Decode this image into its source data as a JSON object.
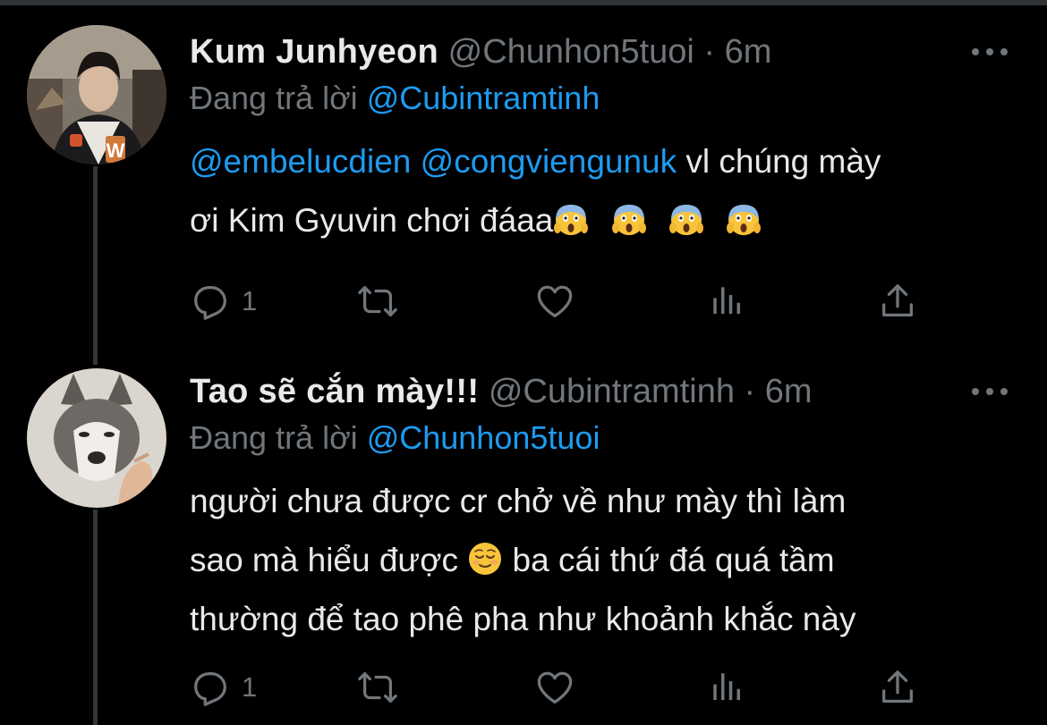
{
  "thread": [
    {
      "display_name": "Kum Junhyeon",
      "handle": "@Chunhon5tuoi",
      "separator": "·",
      "time": "6m",
      "replying_prefix": "Đang trả lời",
      "replying_to": "@Cubintramtinh",
      "text": {
        "mention_1": "@embelucdien",
        "mention_2": "@congviengunuk",
        "line_1_rest": " vl chúng mày",
        "line_2": "ơi Kim Gyuvin chơi đáaa"
      },
      "emojis": [
        "scream-emoji",
        "scream-emoji",
        "scream-emoji",
        "scream-emoji"
      ],
      "actions": {
        "reply_count": "1",
        "retweet_count": "",
        "like_count": ""
      },
      "avatar_icon": "avatar-person-photo"
    },
    {
      "display_name": "Tao sẽ cắn mày!!!",
      "handle": "@Cubintramtinh",
      "separator": "·",
      "time": "6m",
      "replying_prefix": "Đang trả lời",
      "replying_to": "@Chunhon5tuoi",
      "text": {
        "line_1": "người chưa được cr chở về như mày thì làm",
        "line_2_a": "sao mà hiểu được ",
        "line_2_b": "  ba cái thứ đá quá tầm",
        "line_3": "thường để tao phê pha như khoảnh khắc này"
      },
      "emojis": [
        "relieved-face-emoji"
      ],
      "actions": {
        "reply_count": "1",
        "retweet_count": "",
        "like_count": ""
      },
      "avatar_icon": "avatar-husky-dog-photo"
    }
  ],
  "icons": [
    "reply-icon",
    "retweet-icon",
    "like-icon",
    "analytics-icon",
    "share-icon",
    "more-icon"
  ],
  "colors": {
    "background": "#000000",
    "text_primary": "#e7e9ea",
    "text_secondary": "#71767b",
    "link": "#1d9bf0",
    "thread_line": "#333639"
  }
}
